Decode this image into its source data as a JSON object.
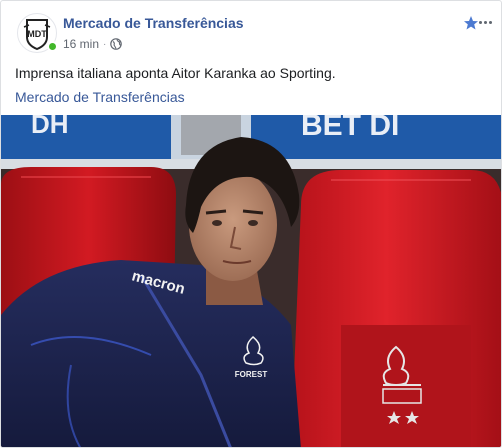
{
  "post": {
    "page_name": "Mercado de Transferências",
    "timestamp": "16 min",
    "separator": "·",
    "audience_icon": "globe-icon",
    "avatar_text": "MDT",
    "text": "Imprensa italiana aponta Aitor Karanka ao Sporting.",
    "source_link": "Mercado de Transferências",
    "star_icon": "star-icon",
    "more_icon": "more-options-icon"
  },
  "photo": {
    "board_text_left": "DH",
    "board_text_right": "BET DI",
    "jacket_brand": "macron",
    "crest_text": "FOREST"
  },
  "colors": {
    "link_blue": "#385898",
    "online_green": "#42b72a",
    "seat_red": "#c8141b",
    "jacket_navy": "#1e2550",
    "board_blue": "#1f5aa8"
  }
}
